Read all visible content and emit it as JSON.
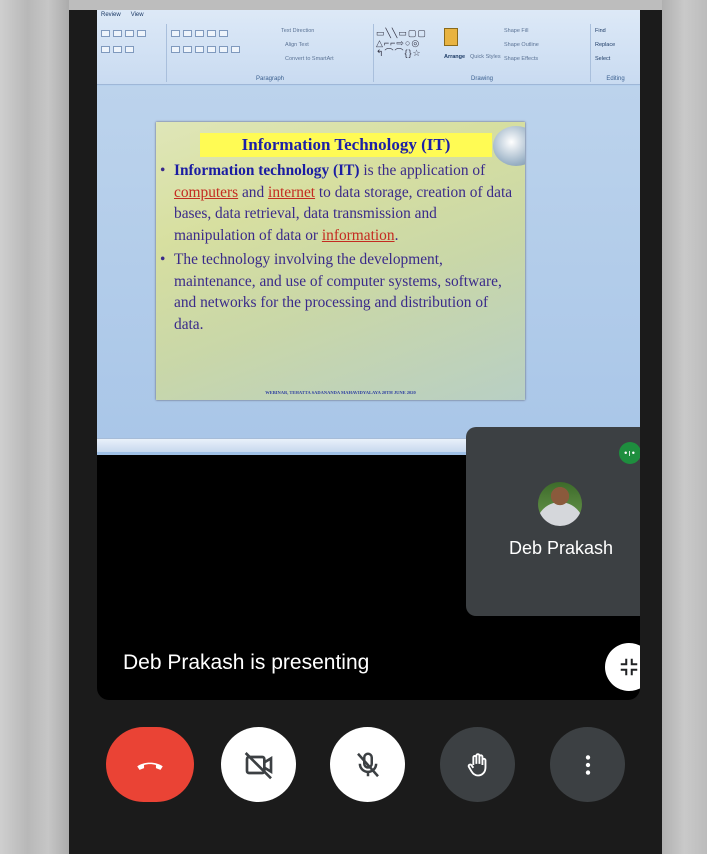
{
  "ribbon": {
    "tabs": [
      "Review",
      "View"
    ],
    "paragraph_label": "Paragraph",
    "drawing_label": "Drawing",
    "editing_label": "Editing",
    "text_direction": "Text Direction",
    "align_text": "Align Text",
    "convert_smartart": "Convert to SmartArt",
    "arrange": "Arrange",
    "quick_styles": "Quick Styles",
    "shape_fill": "Shape Fill",
    "shape_outline": "Shape Outline",
    "shape_effects": "Shape Effects",
    "find": "Find",
    "replace": "Replace",
    "select": "Select"
  },
  "slide": {
    "title": "Information Technology (IT)",
    "bullet1": {
      "bold": "Information technology (IT)",
      "t1": " is the application of ",
      "link1": "computers",
      "t2": " and ",
      "link2": "internet",
      "t3": " to data storage, creation of data bases, data retrieval, data transmission and manipulation of data  or ",
      "link3": "information",
      "t4": "."
    },
    "bullet2": "The technology involving the development, maintenance, and use of computer systems, software, and networks for the processing and distribution of data.",
    "footer": "WEBINAR, TEHATTA SADANANDA MAHAVIDYALAYA 20TH JUNE 2020"
  },
  "participant": {
    "name": "Deb Prakash",
    "speaking_icon": "audio-level-icon"
  },
  "status": {
    "presenting_text": "Deb Prakash is presenting"
  },
  "controls": [
    {
      "name": "end-call-button",
      "icon": "phone-hangup-icon",
      "color": "#ea4335"
    },
    {
      "name": "camera-toggle-button",
      "icon": "video-off-icon",
      "color": "#ffffff"
    },
    {
      "name": "mic-toggle-button",
      "icon": "mic-off-icon",
      "color": "#ffffff"
    },
    {
      "name": "raise-hand-button",
      "icon": "hand-icon",
      "color": "#3c4043"
    },
    {
      "name": "more-options-button",
      "icon": "more-vert-icon",
      "color": "#3c4043"
    }
  ],
  "colors": {
    "accent_red": "#ea4335",
    "tile_bg": "#3c4043",
    "speaking_green": "#1e8e3e"
  }
}
